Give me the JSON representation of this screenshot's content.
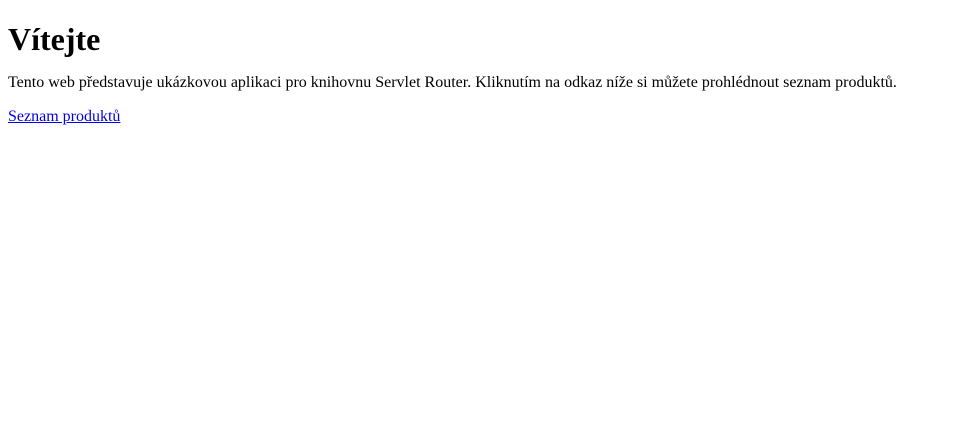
{
  "page": {
    "heading": "Vítejte",
    "intro_text": "Tento web představuje ukázkovou aplikaci pro knihovnu Servlet Router. Kliknutím na odkaz níže si můžete prohlédnout seznam produktů.",
    "products_link_label": "Seznam produktů"
  },
  "colors": {
    "text": "#000000",
    "link": "#0000ee",
    "background": "#ffffff"
  }
}
